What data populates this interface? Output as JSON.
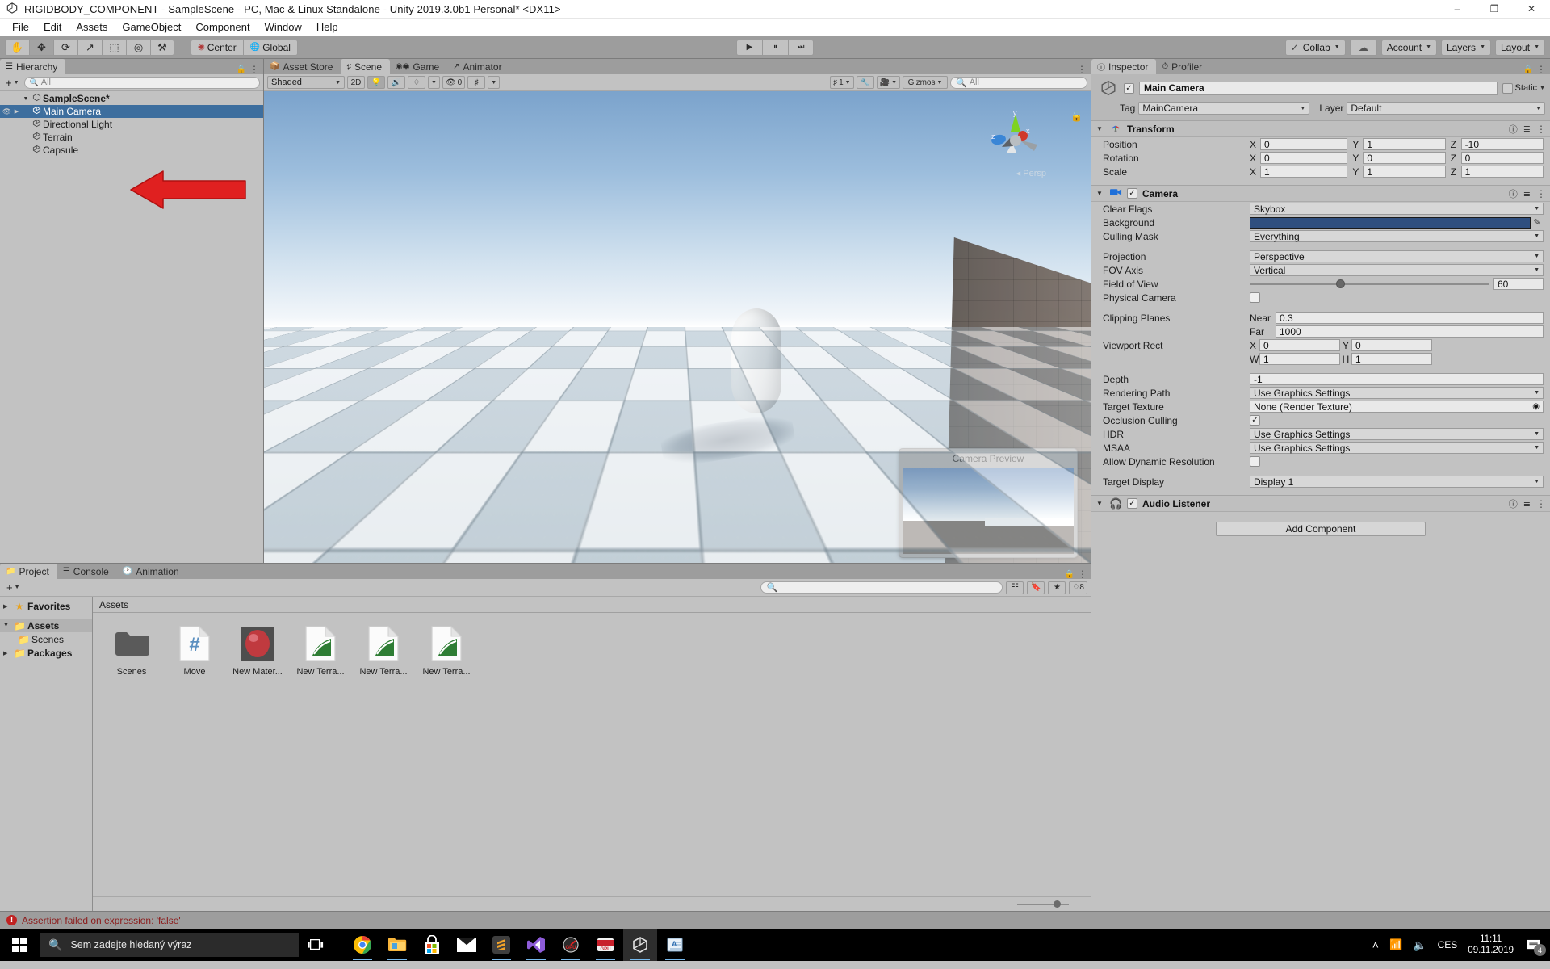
{
  "window": {
    "title": "RIGIDBODY_COMPONENT - SampleScene - PC, Mac & Linux Standalone - Unity 2019.3.0b1 Personal* <DX11>",
    "app_icon": "unity-icon",
    "minimize": "–",
    "maximize": "❐",
    "close": "✕"
  },
  "menu": {
    "items": [
      "File",
      "Edit",
      "Assets",
      "GameObject",
      "Component",
      "Window",
      "Help"
    ]
  },
  "toolbar": {
    "tools": [
      {
        "name": "hand-tool",
        "glyph": "✋"
      },
      {
        "name": "move-tool",
        "glyph": "✥"
      },
      {
        "name": "rotate-tool",
        "glyph": "⟳"
      },
      {
        "name": "scale-tool",
        "glyph": "↗"
      },
      {
        "name": "rect-tool",
        "glyph": "⬚"
      },
      {
        "name": "transform-tool",
        "glyph": "◎"
      },
      {
        "name": "custom-tool",
        "glyph": "⚒"
      }
    ],
    "pivot": "Center",
    "handle": "Global",
    "play": "▶",
    "pause": "⏸",
    "step": "⏭",
    "collab": "Collab",
    "cloud": "☁",
    "account": "Account",
    "layers": "Layers",
    "layout": "Layout"
  },
  "hierarchy": {
    "tab": "Hierarchy",
    "create_label": "+",
    "search_placeholder": "All",
    "items": [
      {
        "label": "SampleScene*",
        "depth": 0,
        "type": "scene",
        "selected": false,
        "expanded": true
      },
      {
        "label": "Main Camera",
        "depth": 1,
        "type": "gameobject",
        "selected": true
      },
      {
        "label": "Directional Light",
        "depth": 1,
        "type": "gameobject",
        "selected": false
      },
      {
        "label": "Terrain",
        "depth": 1,
        "type": "gameobject",
        "selected": false
      },
      {
        "label": "Capsule",
        "depth": 1,
        "type": "gameobject",
        "selected": false
      }
    ]
  },
  "scene_view": {
    "tabs": [
      {
        "label": "Asset Store",
        "icon": "store-icon",
        "active": false
      },
      {
        "label": "Scene",
        "icon": "grid-icon",
        "active": true
      },
      {
        "label": "Game",
        "icon": "gamepad-icon",
        "active": false
      },
      {
        "label": "Animator",
        "icon": "animator-icon",
        "active": false
      }
    ],
    "draw_mode": "Shaded",
    "mode_2d": "2D",
    "lighting_icon": "lightbulb-icon",
    "audio_icon": "speaker-icon",
    "fx_icon": "fx-icon",
    "hidden_count": "0",
    "grid_icon": "grid-snap-icon",
    "layers_count": "1",
    "tools_icon": "wrench-icon",
    "camera_icon": "camera-icon",
    "gizmos": "Gizmos",
    "search_placeholder": "All",
    "gizmo_labels": {
      "x": "x",
      "y": "y",
      "z": "z",
      "persp": "Persp"
    },
    "camera_preview_title": "Camera Preview"
  },
  "inspector": {
    "tabs": [
      {
        "label": "Inspector",
        "icon": "info-icon",
        "active": true
      },
      {
        "label": "Profiler",
        "icon": "stopwatch-icon",
        "active": false
      }
    ],
    "object_name": "Main Camera",
    "object_enabled": true,
    "static_label": "Static",
    "tag_label": "Tag",
    "tag_value": "MainCamera",
    "layer_label": "Layer",
    "layer_value": "Default",
    "components": [
      {
        "name": "Transform",
        "icon": "transform-icon",
        "rows": [
          {
            "label": "Position",
            "type": "vec3",
            "x": "0",
            "y": "1",
            "z": "-10"
          },
          {
            "label": "Rotation",
            "type": "vec3",
            "x": "0",
            "y": "0",
            "z": "0"
          },
          {
            "label": "Scale",
            "type": "vec3",
            "x": "1",
            "y": "1",
            "z": "1"
          }
        ]
      },
      {
        "name": "Camera",
        "icon": "camera-icon",
        "enabled": true,
        "rows": [
          {
            "label": "Clear Flags",
            "type": "dropdown",
            "value": "Skybox"
          },
          {
            "label": "Background",
            "type": "color",
            "value": "#2f4f7f"
          },
          {
            "label": "Culling Mask",
            "type": "dropdown",
            "value": "Everything"
          },
          {
            "label": "",
            "type": "spacer"
          },
          {
            "label": "Projection",
            "type": "dropdown",
            "value": "Perspective"
          },
          {
            "label": "FOV Axis",
            "type": "dropdown",
            "value": "Vertical"
          },
          {
            "label": "Field of View",
            "type": "slider",
            "value": "60",
            "percent": 37
          },
          {
            "label": "Physical Camera",
            "type": "checkbox",
            "checked": false
          },
          {
            "label": "",
            "type": "spacer"
          },
          {
            "label": "Clipping Planes",
            "type": "pair",
            "sub1": "Near",
            "val1": "0.3",
            "sub2": "Far",
            "val2": "1000"
          },
          {
            "label": "Viewport Rect",
            "type": "rect",
            "x": "0",
            "y": "0",
            "w": "1",
            "h": "1"
          },
          {
            "label": "",
            "type": "spacer"
          },
          {
            "label": "Depth",
            "type": "text",
            "value": "-1"
          },
          {
            "label": "Rendering Path",
            "type": "dropdown",
            "value": "Use Graphics Settings"
          },
          {
            "label": "Target Texture",
            "type": "object",
            "value": "None (Render Texture)"
          },
          {
            "label": "Occlusion Culling",
            "type": "checkbox",
            "checked": true
          },
          {
            "label": "HDR",
            "type": "dropdown",
            "value": "Use Graphics Settings"
          },
          {
            "label": "MSAA",
            "type": "dropdown",
            "value": "Use Graphics Settings"
          },
          {
            "label": "Allow Dynamic Resolution",
            "type": "checkbox",
            "checked": false
          },
          {
            "label": "",
            "type": "spacer"
          },
          {
            "label": "Target Display",
            "type": "dropdown",
            "value": "Display 1"
          }
        ]
      },
      {
        "name": "Audio Listener",
        "icon": "headphones-icon",
        "enabled": true,
        "rows": []
      }
    ],
    "add_component": "Add Component"
  },
  "project": {
    "tabs": [
      {
        "label": "Project",
        "icon": "folder-icon",
        "active": true
      },
      {
        "label": "Console",
        "icon": "console-icon",
        "active": false
      },
      {
        "label": "Animation",
        "icon": "clock-icon",
        "active": false
      }
    ],
    "create_label": "+",
    "search_placeholder": "",
    "breadcrumb": "Assets",
    "tree": [
      {
        "label": "Favorites",
        "icon": "star-icon",
        "depth": 0,
        "expanded": false,
        "selected": false
      },
      {
        "label": "Assets",
        "icon": "folder-icon",
        "depth": 0,
        "expanded": true,
        "selected": true
      },
      {
        "label": "Scenes",
        "icon": "folder-icon",
        "depth": 1,
        "expanded": null,
        "selected": false
      },
      {
        "label": "Packages",
        "icon": "folder-icon",
        "depth": 0,
        "expanded": false,
        "selected": false
      }
    ],
    "assets": [
      {
        "label": "Scenes",
        "kind": "folder"
      },
      {
        "label": "Move",
        "kind": "csharp"
      },
      {
        "label": "New Mater...",
        "kind": "material"
      },
      {
        "label": "New Terra...",
        "kind": "terrain"
      },
      {
        "label": "New Terra...",
        "kind": "terrain"
      },
      {
        "label": "New Terra...",
        "kind": "terrain"
      }
    ]
  },
  "status": {
    "icon": "error-icon",
    "message": "Assertion failed on expression: 'false'"
  },
  "taskbar": {
    "start_icon": "windows-logo",
    "search_placeholder": "Sem zadejte hledaný výraz",
    "search_icon": "search-icon",
    "task_view_icon": "task-view-icon",
    "apps": [
      {
        "name": "chrome-icon",
        "running": true,
        "active": false
      },
      {
        "name": "file-explorer-icon",
        "running": true,
        "active": false
      },
      {
        "name": "microsoft-store-icon",
        "running": false,
        "active": false
      },
      {
        "name": "mail-icon",
        "running": false,
        "active": false
      },
      {
        "name": "sublime-text-icon",
        "running": true,
        "active": false
      },
      {
        "name": "visual-studio-icon",
        "running": true,
        "active": false
      },
      {
        "name": "gpu-tweak-icon",
        "running": true,
        "active": false
      },
      {
        "name": "gpu-tweak-2-icon",
        "running": true,
        "active": false
      },
      {
        "name": "unity-icon",
        "running": true,
        "active": true
      },
      {
        "name": "wordpad-icon",
        "running": true,
        "active": false
      }
    ],
    "tray": {
      "chevron": "˄",
      "wifi_icon": "wifi-icon",
      "volume_icon": "volume-icon",
      "language": "CES",
      "time": "11:11",
      "date": "09.11.2019",
      "notification_icon": "notification-icon",
      "notification_count": "4"
    }
  }
}
